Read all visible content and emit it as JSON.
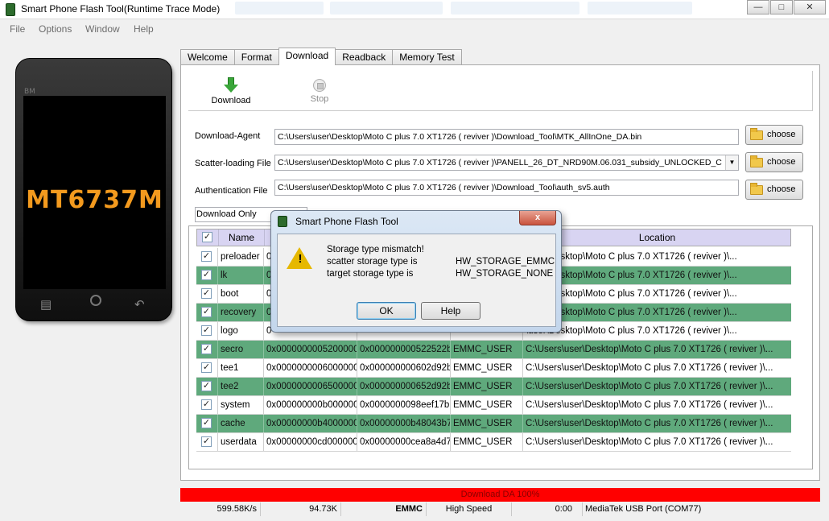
{
  "window": {
    "title": "Smart Phone Flash Tool(Runtime Trace Mode)"
  },
  "menu": [
    "File",
    "Options",
    "Window",
    "Help"
  ],
  "phone": {
    "brand": "BM",
    "chip": "MT6737M"
  },
  "tabs": [
    "Welcome",
    "Format",
    "Download",
    "Readback",
    "Memory Test"
  ],
  "toolbar": {
    "download": "Download",
    "stop": "Stop"
  },
  "fields": {
    "download_agent": {
      "label": "Download-Agent",
      "value": "C:\\Users\\user\\Desktop\\Moto C plus  7.0  XT1726 ( reviver )\\Download_Tool\\MTK_AllInOne_DA.bin"
    },
    "scatter": {
      "label": "Scatter-loading File",
      "value": "C:\\Users\\user\\Desktop\\Moto C plus  7.0  XT1726 ( reviver )\\PANELL_26_DT_NRD90M.06.031_subsidy_UNLOCKED_C"
    },
    "auth": {
      "label": "Authentication File",
      "value": "C:\\Users\\user\\Desktop\\Moto C plus  7.0  XT1726 ( reviver )\\Download_Tool\\auth_sv5.auth"
    },
    "choose_label": "choose"
  },
  "mode": "Download Only",
  "table": {
    "headers": [
      "Name",
      "Location"
    ],
    "rows": [
      {
        "name": "preloader",
        "begin": "0",
        "end": "",
        "region": "",
        "location": "\\user\\Desktop\\Moto C plus  7.0  XT1726 ( reviver )\\..."
      },
      {
        "name": "lk",
        "begin": "0",
        "end": "",
        "region": "",
        "location": "\\user\\Desktop\\Moto C plus  7.0  XT1726 ( reviver )\\..."
      },
      {
        "name": "boot",
        "begin": "0",
        "end": "",
        "region": "",
        "location": "\\user\\Desktop\\Moto C plus  7.0  XT1726 ( reviver )\\..."
      },
      {
        "name": "recovery",
        "begin": "0",
        "end": "",
        "region": "",
        "location": "\\user\\Desktop\\Moto C plus  7.0  XT1726 ( reviver )\\..."
      },
      {
        "name": "logo",
        "begin": "0",
        "end": "",
        "region": "",
        "location": "\\user\\Desktop\\Moto C plus  7.0  XT1726 ( reviver )\\..."
      },
      {
        "name": "secro",
        "begin": "0x0000000005200000",
        "end": "0x000000000522522b",
        "region": "EMMC_USER",
        "location": "C:\\Users\\user\\Desktop\\Moto C plus  7.0  XT1726 ( reviver )\\..."
      },
      {
        "name": "tee1",
        "begin": "0x0000000006000000",
        "end": "0x000000000602d92b",
        "region": "EMMC_USER",
        "location": "C:\\Users\\user\\Desktop\\Moto C plus  7.0  XT1726 ( reviver )\\..."
      },
      {
        "name": "tee2",
        "begin": "0x0000000006500000",
        "end": "0x000000000652d92b",
        "region": "EMMC_USER",
        "location": "C:\\Users\\user\\Desktop\\Moto C plus  7.0  XT1726 ( reviver )\\..."
      },
      {
        "name": "system",
        "begin": "0x000000000b000000",
        "end": "0x0000000098eef17b",
        "region": "EMMC_USER",
        "location": "C:\\Users\\user\\Desktop\\Moto C plus  7.0  XT1726 ( reviver )\\..."
      },
      {
        "name": "cache",
        "begin": "0x00000000b4000000",
        "end": "0x00000000b48043b7",
        "region": "EMMC_USER",
        "location": "C:\\Users\\user\\Desktop\\Moto C plus  7.0  XT1726 ( reviver )\\..."
      },
      {
        "name": "userdata",
        "begin": "0x00000000cd000000",
        "end": "0x00000000cea8a4d7",
        "region": "EMMC_USER",
        "location": "C:\\Users\\user\\Desktop\\Moto C plus  7.0  XT1726 ( reviver )\\..."
      }
    ]
  },
  "progress": {
    "label": "Download DA 100%",
    "value": 1.0
  },
  "status": {
    "speed": "599.58K/s",
    "size": "94.73K",
    "storage": "EMMC",
    "mode": "High Speed",
    "time": "0:00",
    "port": "MediaTek USB Port (COM77)"
  },
  "dialog": {
    "title": "Smart Phone Flash Tool",
    "close": "x",
    "line1": "Storage type mismatch!",
    "line2_label": "scatter storage type is",
    "line2_value": "HW_STORAGE_EMMC",
    "line3_label": "target storage type is",
    "line3_value": "HW_STORAGE_NONE",
    "ok": "OK",
    "help": "Help"
  },
  "colors": {
    "row_alt": "#5fa97c",
    "header": "#d8d4f2",
    "progress": "#ff0000",
    "chip_text": "#f39a1e"
  }
}
